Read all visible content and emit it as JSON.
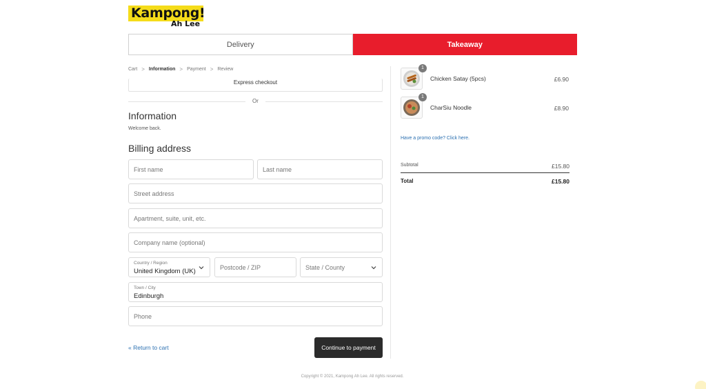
{
  "brand": {
    "name": "Kampong!",
    "sub": "Ah Lee"
  },
  "tabs": {
    "delivery": "Delivery",
    "takeaway": "Takeaway"
  },
  "breadcrumb": {
    "cart": "Cart",
    "information": "Information",
    "payment": "Payment",
    "review": "Review",
    "separator": ">"
  },
  "express_checkout": "Express checkout",
  "or_label": "Or",
  "information": {
    "heading": "Information",
    "welcome": "Welcome back."
  },
  "billing": {
    "heading": "Billing address",
    "first_name_placeholder": "First name",
    "last_name_placeholder": "Last name",
    "street_placeholder": "Street address",
    "apartment_placeholder": "Apartment, suite, unit, etc.",
    "company_placeholder": "Company name (optional)",
    "country_label": "Country / Region",
    "country_value": "United Kingdom (UK)",
    "postcode_placeholder": "Postcode / ZIP",
    "state_placeholder": "State / County",
    "town_label": "Town / City",
    "town_value": "Edinburgh",
    "phone_placeholder": "Phone"
  },
  "actions": {
    "return_label": "« Return to cart",
    "continue_label": "Continue to payment"
  },
  "order": {
    "items": [
      {
        "name": "Chicken Satay (5pcs)",
        "price": "£6.90",
        "qty": "1"
      },
      {
        "name": "CharSiu Noodle",
        "price": "£8.90",
        "qty": "1"
      }
    ],
    "promo_text": "Have a promo code? Click here.",
    "subtotal_label": "Subtotal",
    "subtotal_value": "£15.80",
    "total_label": "Total",
    "total_value": "£15.80"
  },
  "footer": "Copyright © 2021, Kampong Ah Lee. All rights reserved.",
  "colors": {
    "accent_red": "#e81d2c",
    "logo_yellow": "#f5dc1a",
    "button_dark": "#2b2b2b",
    "link_blue": "#2a6fb0"
  }
}
